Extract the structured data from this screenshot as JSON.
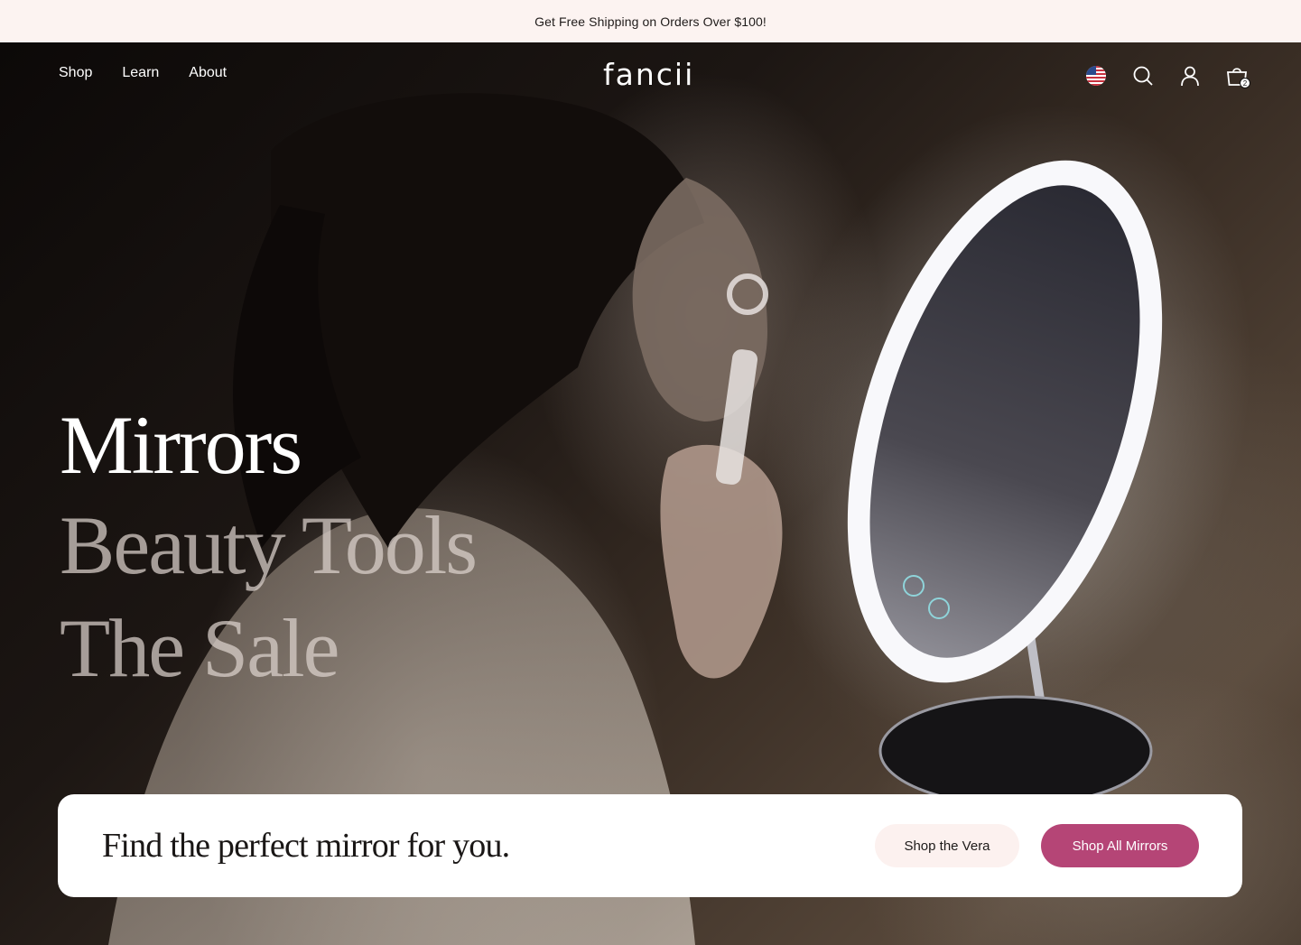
{
  "announcement": {
    "text": "Get Free Shipping on Orders Over $100!"
  },
  "nav": {
    "links": [
      {
        "label": "Shop"
      },
      {
        "label": "Learn"
      },
      {
        "label": "About"
      }
    ],
    "logo": "fancii",
    "icons": [
      "us-flag-icon",
      "search-icon",
      "account-icon",
      "cart-icon"
    ],
    "cart_count": "2"
  },
  "hero": {
    "headlines": [
      "Mirrors",
      "Beauty Tools",
      "The Sale"
    ]
  },
  "cta": {
    "title": "Find the perfect mirror for you.",
    "secondary_button": "Shop the Vera",
    "primary_button": "Shop All Mirrors"
  },
  "colors": {
    "announcement_bg": "#fcf3f1",
    "primary_button": "#b54576",
    "secondary_button": "#fcf1ef"
  }
}
